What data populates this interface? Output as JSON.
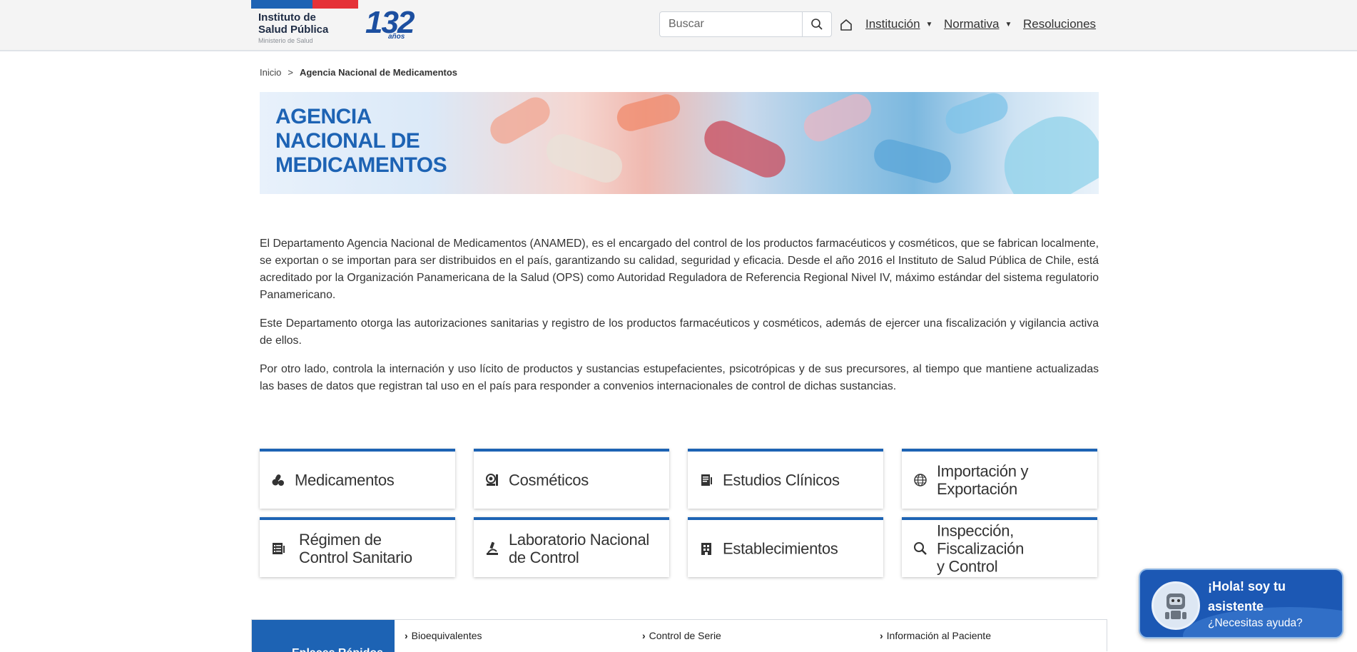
{
  "header": {
    "logo": {
      "line1": "Instituto de",
      "line2": "Salud Pública",
      "line3": "Ministerio de Salud",
      "anniversary_number": "132",
      "anniversary_label": "años"
    },
    "search": {
      "placeholder": "Buscar"
    },
    "nav": [
      {
        "label": "Institución",
        "has_dropdown": true
      },
      {
        "label": "Normativa",
        "has_dropdown": true
      },
      {
        "label": "Resoluciones",
        "has_dropdown": false
      }
    ],
    "colors": {
      "blue": "#1e63b4",
      "red": "#e53238"
    }
  },
  "breadcrumb": {
    "home": "Inicio",
    "separator": ">",
    "current": "Agencia Nacional de Medicamentos"
  },
  "banner": {
    "title_line1": "AGENCIA",
    "title_line2": "NACIONAL DE",
    "title_line3": "MEDICAMENTOS"
  },
  "content": {
    "paragraphs": [
      "El Departamento Agencia Nacional de Medicamentos (ANAMED), es el encargado del control de los productos farmacéuticos y cosméticos, que se fabrican localmente, se exportan o se importan para ser distribuidos en el país, garantizando su calidad, seguridad y eficacia. Desde el año 2016 el Instituto de Salud Pública de Chile, está acreditado por la Organización Panamericana de la Salud (OPS) como Autoridad Reguladora de Referencia Regional Nivel IV, máximo estándar del sistema regulatorio Panamericano.",
      "Este Departamento otorga las autorizaciones sanitarias y registro de los productos farmacéuticos y cosméticos, además de ejercer una fiscalización y vigilancia activa de ellos.",
      "Por otro lado, controla la internación y uso lícito de productos y sustancias estupefacientes, psicotrópicas y de sus precursores, al tiempo que mantiene actualizadas las bases de datos que registran tal uso en el país para responder a convenios internacionales de control de dichas sustancias."
    ]
  },
  "cards": [
    {
      "icon": "pills-icon",
      "line1": "Medicamentos",
      "line2": ""
    },
    {
      "icon": "cosmetics-icon",
      "line1": "Cosméticos",
      "line2": ""
    },
    {
      "icon": "document-icon",
      "line1": "Estudios Clínicos",
      "line2": ""
    },
    {
      "icon": "globe-icon",
      "line1": "Importación y Exportación",
      "line2": ""
    },
    {
      "icon": "checklist-icon",
      "line1": "Régimen de",
      "line2": "Control Sanitario"
    },
    {
      "icon": "microscope-icon",
      "line1": "Laboratorio Nacional",
      "line2": "de Control"
    },
    {
      "icon": "building-icon",
      "line1": "Establecimientos",
      "line2": ""
    },
    {
      "icon": "search-icon",
      "line1": "Inspección, Fiscalización",
      "line2": "y Control"
    }
  ],
  "quick_links": {
    "title": "Enlaces Rápidos",
    "items": [
      "Bioequivalentes",
      "Control de Serie",
      "Información al Paciente"
    ]
  },
  "assistant": {
    "greeting": "¡Hola! soy tu asistente",
    "prompt": "¿Necesitas ayuda?"
  }
}
